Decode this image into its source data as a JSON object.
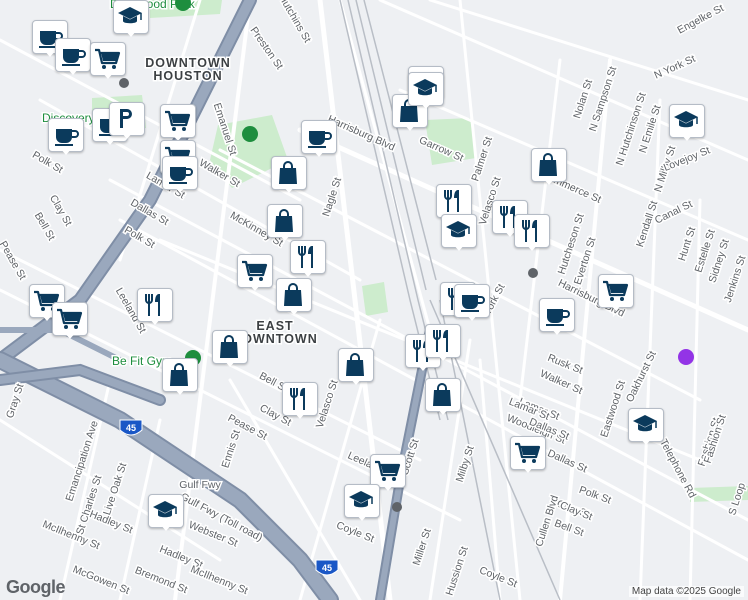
{
  "map": {
    "provider_logo": "Google",
    "attribution": "Map data ©2025 Google",
    "colors": {
      "background": "#eef0f3",
      "road": "#ffffff",
      "freeway": "#9aa8bd",
      "freeway_casing": "#7f8ea6",
      "park": "#cdeccd",
      "rail": "#b9bec6",
      "marker_icon": "#0b3a5c",
      "park_icon": "#1e8e3e",
      "landmark_icon": "#9334e6"
    },
    "area_labels": [
      "DOWNTOWN",
      "HOUSTON",
      "EAST",
      "DOWNTOWN"
    ],
    "poi_labels": [
      "Discovery",
      "Dashwood Park",
      "Be Fit Gym"
    ],
    "streets": [
      "Hutchins St",
      "Preston St",
      "Engelke St",
      "N York St",
      "Nolan St",
      "N Sampson St",
      "N Hutchinson St",
      "N Emile St",
      "N Milby St",
      "Lovejoy St",
      "Canal St",
      "Kendall St",
      "Hunt St",
      "Estelle St",
      "Sidney St",
      "Jenkins St",
      "Harrisburg Blvd",
      "Garrow St",
      "Palmer St",
      "Velasco St",
      "Commerce St",
      "Hutcheson St",
      "Everton St",
      "York St",
      "Harrisburg Blvd",
      "Oakhurst St",
      "Rusk St",
      "Walker St",
      "Lamar St",
      "Woodleigh St",
      "Dallas St",
      "Polk St",
      "Clay St",
      "Bell St",
      "Eastwood St",
      "Fashion St",
      "Telephone Rd",
      "Cullen Blvd",
      "Milby St",
      "Hussion St",
      "Miller St",
      "Scott St",
      "Coyle St",
      "Leeland St",
      "Nagle St",
      "McKinney St",
      "Walker St",
      "Lamar St",
      "Dallas St",
      "Polk St",
      "Clay St",
      "Bell St",
      "Leeland St",
      "Pease St",
      "Gray St",
      "Emancipation Ave",
      "St Charles St",
      "Live Oak St",
      "Hadley St",
      "McIlhenny St",
      "Webster St",
      "Hadley St",
      "McIlhenny St",
      "Bremond St",
      "McGowen St",
      "Ennis St",
      "Pease St",
      "Velasco St",
      "Bell St",
      "Clay St",
      "Emanuel St",
      "Polk St",
      "Gulf Fwy",
      "Gulf Fwy (Toll road)",
      "Fashion St",
      "Coyle St",
      "Lamar St",
      "Dallas St",
      "Clay St",
      "S Loop"
    ],
    "highway_shields": [
      "45",
      "45"
    ],
    "markers": [
      {
        "type": "school"
      },
      {
        "type": "coffee"
      },
      {
        "type": "coffee"
      },
      {
        "type": "grocery"
      },
      {
        "type": "coffee"
      },
      {
        "type": "coffee"
      },
      {
        "type": "parking"
      },
      {
        "type": "grocery"
      },
      {
        "type": "grocery"
      },
      {
        "type": "coffee"
      },
      {
        "type": "coffee"
      },
      {
        "type": "shopping"
      },
      {
        "type": "shopping"
      },
      {
        "type": "restaurant"
      },
      {
        "type": "grocery"
      },
      {
        "type": "shopping"
      },
      {
        "type": "restaurant"
      },
      {
        "type": "grocery"
      },
      {
        "type": "grocery"
      },
      {
        "type": "shopping"
      },
      {
        "type": "shopping"
      },
      {
        "type": "school"
      },
      {
        "type": "shopping"
      },
      {
        "type": "school"
      },
      {
        "type": "shopping"
      },
      {
        "type": "restaurant"
      },
      {
        "type": "restaurant"
      },
      {
        "type": "school"
      },
      {
        "type": "restaurant"
      },
      {
        "type": "restaurant"
      },
      {
        "type": "grocery"
      },
      {
        "type": "coffee"
      },
      {
        "type": "restaurant"
      },
      {
        "type": "restaurant"
      },
      {
        "type": "shopping"
      },
      {
        "type": "restaurant"
      },
      {
        "type": "coffee"
      },
      {
        "type": "shopping"
      },
      {
        "type": "grocery"
      },
      {
        "type": "grocery"
      },
      {
        "type": "school"
      },
      {
        "type": "school"
      },
      {
        "type": "school"
      },
      {
        "type": "school"
      }
    ]
  }
}
